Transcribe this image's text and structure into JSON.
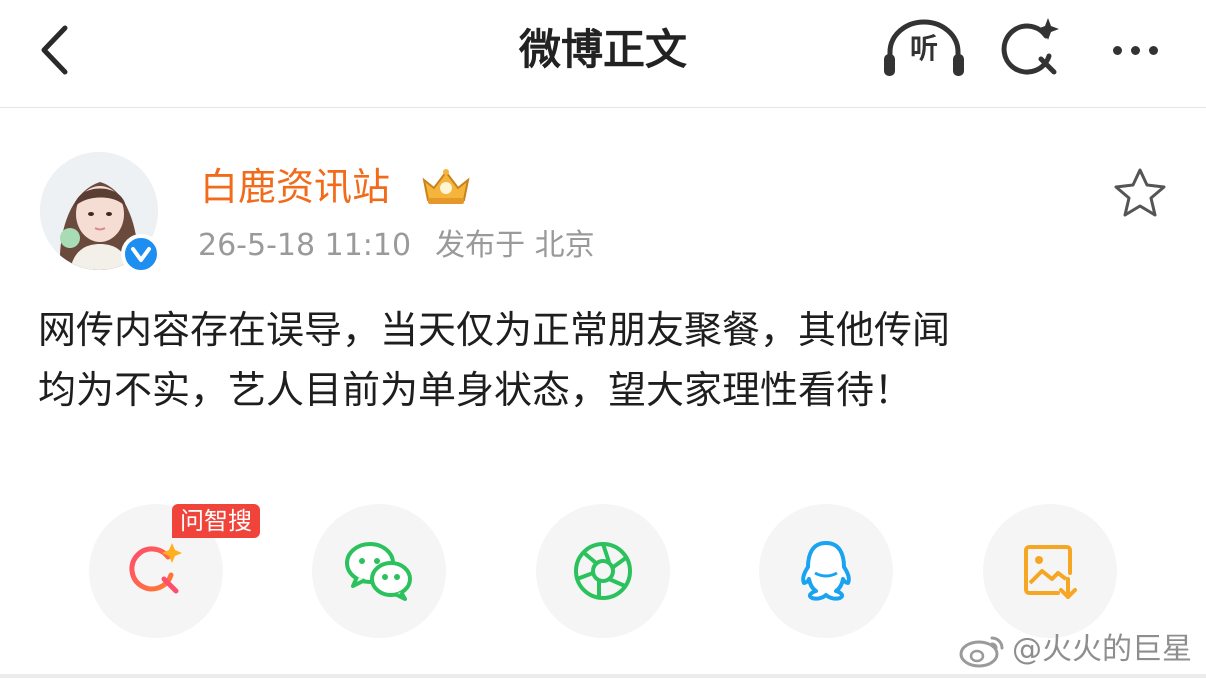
{
  "header": {
    "title": "微博正文",
    "listen_label": "听",
    "icons": [
      "back-arrow-icon",
      "headphones-icon",
      "sparkle-search-icon",
      "more-dots-icon"
    ]
  },
  "post": {
    "author": "白鹿资讯站",
    "time": "26-5-18 11:10",
    "location": "发布于 北京",
    "text": "网传内容存在误导，当天仅为正常朋友聚餐，其他传闻\n均为不实，艺人目前为单身状态，望大家理性看待！"
  },
  "share": {
    "badge": "问智搜",
    "items": [
      "ai-search-icon",
      "wechat-icon",
      "moments-icon",
      "qq-icon",
      "save-image-icon"
    ]
  },
  "watermark": "@火火的巨星",
  "colors": {
    "author": "#f26b1a",
    "verified": "#1e8ff0",
    "badge": "#f0443b",
    "wechat": "#2bc25d",
    "qq": "#1aa3f0",
    "save": "#f5a623"
  }
}
